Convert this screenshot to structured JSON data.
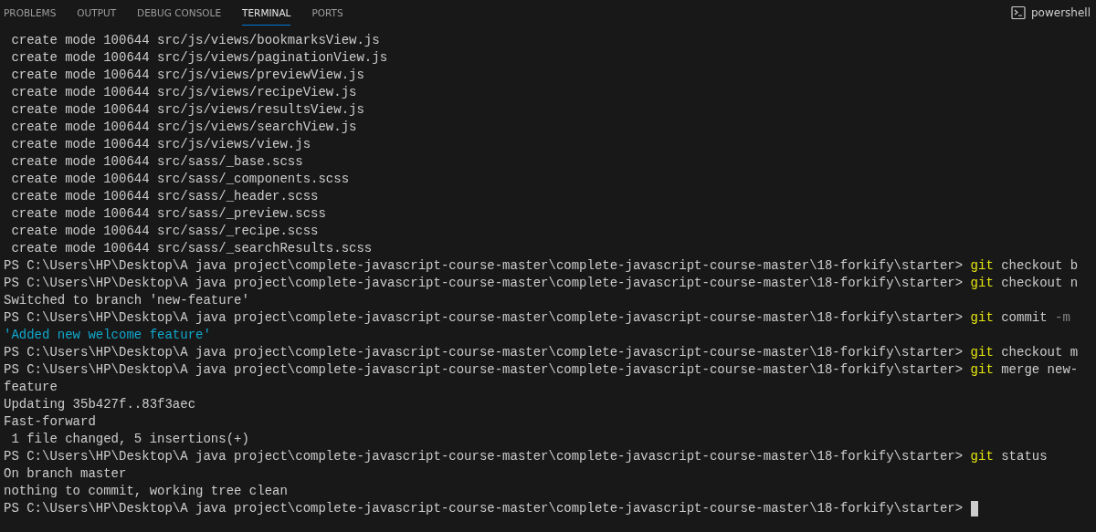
{
  "tabs": [
    {
      "label": "PROBLEMS",
      "selected": false
    },
    {
      "label": "OUTPUT",
      "selected": false
    },
    {
      "label": "DEBUG CONSOLE",
      "selected": false
    },
    {
      "label": "TERMINAL",
      "selected": true
    },
    {
      "label": "PORTS",
      "selected": false
    }
  ],
  "shell": {
    "label": "powershell"
  },
  "terminal": {
    "cursor": true,
    "lines": [
      [
        {
          "kind": "text",
          "text": " create mode 100644 src/js/views/bookmarksView.js"
        }
      ],
      [
        {
          "kind": "text",
          "text": " create mode 100644 src/js/views/paginationView.js"
        }
      ],
      [
        {
          "kind": "text",
          "text": " create mode 100644 src/js/views/previewView.js"
        }
      ],
      [
        {
          "kind": "text",
          "text": " create mode 100644 src/js/views/recipeView.js"
        }
      ],
      [
        {
          "kind": "text",
          "text": " create mode 100644 src/js/views/resultsView.js"
        }
      ],
      [
        {
          "kind": "text",
          "text": " create mode 100644 src/js/views/searchView.js"
        }
      ],
      [
        {
          "kind": "text",
          "text": " create mode 100644 src/js/views/view.js"
        }
      ],
      [
        {
          "kind": "text",
          "text": " create mode 100644 src/sass/_base.scss"
        }
      ],
      [
        {
          "kind": "text",
          "text": " create mode 100644 src/sass/_components.scss"
        }
      ],
      [
        {
          "kind": "text",
          "text": " create mode 100644 src/sass/_header.scss"
        }
      ],
      [
        {
          "kind": "text",
          "text": " create mode 100644 src/sass/_preview.scss"
        }
      ],
      [
        {
          "kind": "text",
          "text": " create mode 100644 src/sass/_recipe.scss"
        }
      ],
      [
        {
          "kind": "text",
          "text": " create mode 100644 src/sass/_searchResults.scss"
        }
      ],
      [
        {
          "kind": "text",
          "text": "PS C:\\Users\\HP\\Desktop\\A java project\\complete-javascript-course-master\\complete-javascript-course-master\\18-forkify\\starter> "
        },
        {
          "kind": "command",
          "text": "git"
        },
        {
          "kind": "text",
          "text": " checkout b"
        }
      ],
      [
        {
          "kind": "text",
          "text": "PS C:\\Users\\HP\\Desktop\\A java project\\complete-javascript-course-master\\complete-javascript-course-master\\18-forkify\\starter> "
        },
        {
          "kind": "command",
          "text": "git"
        },
        {
          "kind": "text",
          "text": " checkout n"
        }
      ],
      [
        {
          "kind": "text",
          "text": "Switched to branch 'new-feature'"
        }
      ],
      [
        {
          "kind": "text",
          "text": "PS C:\\Users\\HP\\Desktop\\A java project\\complete-javascript-course-master\\complete-javascript-course-master\\18-forkify\\starter> "
        },
        {
          "kind": "command",
          "text": "git"
        },
        {
          "kind": "text",
          "text": " commit "
        },
        {
          "kind": "flag",
          "text": "-m"
        }
      ],
      [
        {
          "kind": "string",
          "text": "'Added new welcome feature'"
        }
      ],
      [
        {
          "kind": "text",
          "text": "PS C:\\Users\\HP\\Desktop\\A java project\\complete-javascript-course-master\\complete-javascript-course-master\\18-forkify\\starter> "
        },
        {
          "kind": "command",
          "text": "git"
        },
        {
          "kind": "text",
          "text": " checkout m"
        }
      ],
      [
        {
          "kind": "text",
          "text": "PS C:\\Users\\HP\\Desktop\\A java project\\complete-javascript-course-master\\complete-javascript-course-master\\18-forkify\\starter> "
        },
        {
          "kind": "command",
          "text": "git"
        },
        {
          "kind": "text",
          "text": " merge new-"
        }
      ],
      [
        {
          "kind": "text",
          "text": "feature"
        }
      ],
      [
        {
          "kind": "text",
          "text": "Updating 35b427f..83f3aec"
        }
      ],
      [
        {
          "kind": "text",
          "text": "Fast-forward"
        }
      ],
      [
        {
          "kind": "text",
          "text": " 1 file changed, 5 insertions(+)"
        }
      ],
      [
        {
          "kind": "text",
          "text": "PS C:\\Users\\HP\\Desktop\\A java project\\complete-javascript-course-master\\complete-javascript-course-master\\18-forkify\\starter> "
        },
        {
          "kind": "command",
          "text": "git"
        },
        {
          "kind": "text",
          "text": " status"
        }
      ],
      [
        {
          "kind": "text",
          "text": "On branch master"
        }
      ],
      [
        {
          "kind": "text",
          "text": "nothing to commit, working tree clean"
        }
      ],
      [
        {
          "kind": "text",
          "text": "PS C:\\Users\\HP\\Desktop\\A java project\\complete-javascript-course-master\\complete-javascript-course-master\\18-forkify\\starter> "
        }
      ]
    ]
  }
}
